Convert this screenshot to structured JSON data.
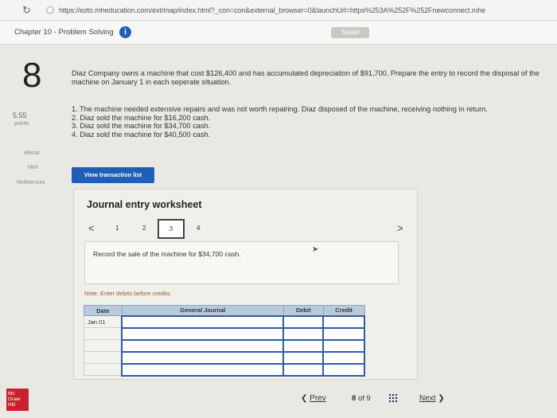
{
  "browser": {
    "url": "https://ezto.mheducation.com/ext/map/index.html?_con=con&external_browser=0&launchUrl=https%253A%252F%252Fnewconnect.mhe"
  },
  "header": {
    "chapter_title": "Chapter 10 - Problem Solving",
    "saved_label": "Saved"
  },
  "question": {
    "number": "8",
    "points_value": "5.55",
    "points_label": "points",
    "problem_text": "Diaz Company owns a machine that cost $126,400 and has accumulated depreciation of $91,700. Prepare the entry to record the disposal of the machine on January 1 in each seperate situation.",
    "situations": [
      "1. The machine needed extensive repairs and was not worth repairing. Diaz disposed of the machine, receiving nothing in return.",
      "2. Diaz sold the machine for $16,200 cash.",
      "3. Diaz sold the machine for $34,700 cash.",
      "4. Diaz sold the machine for $40,500 cash."
    ]
  },
  "sidebar": {
    "links": [
      "eBook",
      "Hint",
      "References"
    ]
  },
  "actions": {
    "view_transaction_list": "View transaction list"
  },
  "worksheet": {
    "title": "Journal entry worksheet",
    "pages": [
      "1",
      "2",
      "3",
      "4"
    ],
    "active_page": "3",
    "prev_arrow": "<",
    "next_arrow": ">",
    "instruction": "Record the sale of the machine for $34,700 cash.",
    "note": "Note: Enter debits before credits.",
    "columns": [
      "Date",
      "General Journal",
      "Debit",
      "Credit"
    ],
    "rows": [
      {
        "date": "Jan 01"
      },
      {
        "date": ""
      },
      {
        "date": ""
      },
      {
        "date": ""
      },
      {
        "date": ""
      }
    ]
  },
  "footer": {
    "logo_text": [
      "Mc",
      "Graw",
      "Hill"
    ],
    "prev_label": "Prev",
    "page_current": "8",
    "page_of": "of 9",
    "next_label": "Next"
  },
  "colors": {
    "accent": "#1f5fb8",
    "table_header": "#b9cadf",
    "logo": "#c8202f"
  }
}
